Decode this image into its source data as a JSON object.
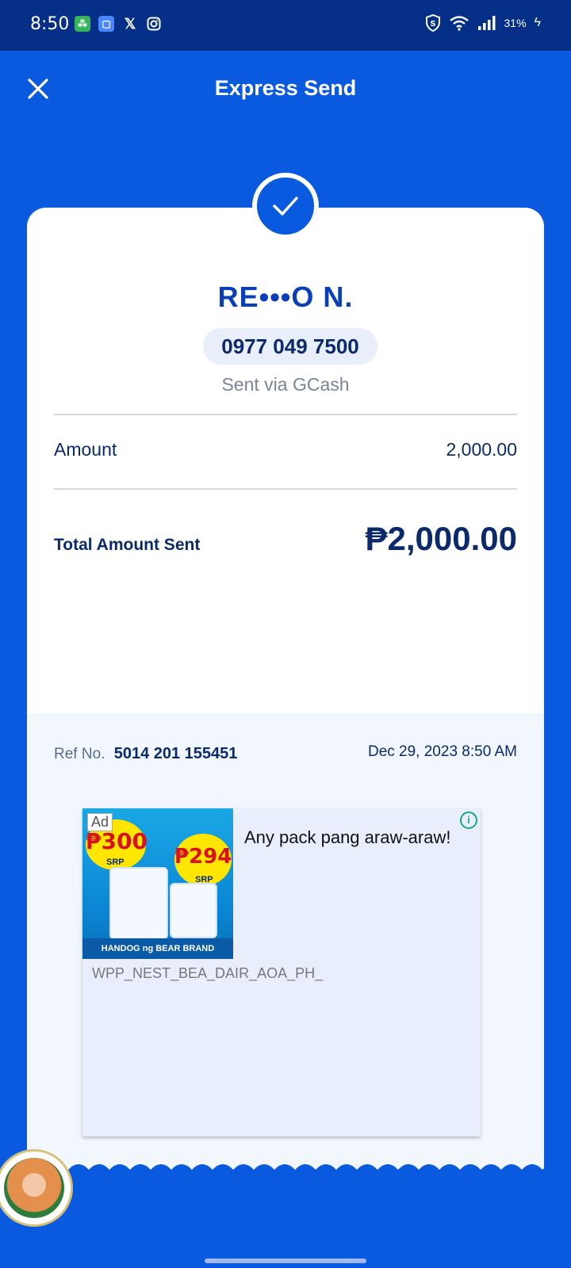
{
  "status_bar": {
    "time": "8:50",
    "battery": "31%"
  },
  "app_bar": {
    "title": "Express Send"
  },
  "recipient": {
    "name": "RE•••O N.",
    "phone": "0977 049 7500",
    "sent_via": "Sent via GCash"
  },
  "summary": {
    "amount_label": "Amount",
    "amount_value": "2,000.00",
    "total_label": "Total Amount Sent",
    "total_value": "₱2,000.00"
  },
  "reference": {
    "label": "Ref No.",
    "number": "5014 201 155451",
    "datetime": "Dec 29, 2023 8:50 AM"
  },
  "ad": {
    "badge": "Ad",
    "headline": "Any pack pang araw-araw!",
    "caption": "WPP_NEST_BEA_DAIR_AOA_PH_",
    "price_1": "₱300",
    "price_2": "₱294",
    "srp": "SRP",
    "strip_text": "HANDOG ng BEAR BRAND"
  },
  "colors": {
    "primary": "#0a5ae0",
    "status_bar": "#063088",
    "text_dark": "#0a2a6b"
  }
}
